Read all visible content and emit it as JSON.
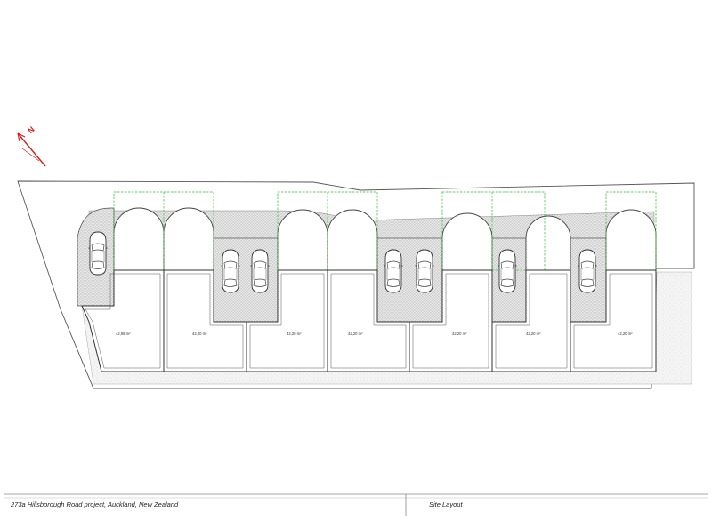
{
  "title_block": {
    "project": "273a Hillsborough Road project, Auckland, New Zealand",
    "sheet_title": "Site Layout"
  },
  "north_arrow": {
    "label": "N",
    "color": "#d42020",
    "icon": "north-arrow-icon"
  },
  "units": [
    {
      "area": "42,98 m²"
    },
    {
      "area": "42,20 m²"
    },
    {
      "area": "42,20 m²"
    },
    {
      "area": "42,20 m²"
    },
    {
      "area": "42,20 m²"
    },
    {
      "area": "42,20 m²"
    },
    {
      "area": "42,20 m²"
    }
  ],
  "colors": {
    "line": "#444444",
    "hatch": "#d8d8d8",
    "planting_outline": "#33bb33",
    "north_arrow": "#d42020"
  }
}
